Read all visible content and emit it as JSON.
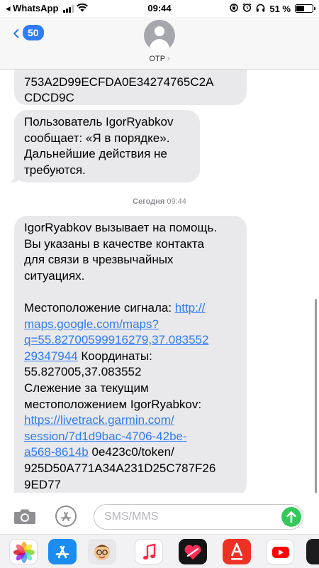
{
  "status_bar": {
    "back_app": "◂ WhatsApp",
    "time": "09:44",
    "battery_text": "51 %",
    "battery_level_percent": 51
  },
  "header": {
    "back_badge": "50",
    "contact_name": "OTP",
    "contact_chevron": "›"
  },
  "messages": {
    "msg1": {
      "lines": [
        "753A2D99ECFDA0E34274765C2A",
        "CDCD9C"
      ]
    },
    "msg2": {
      "lines": [
        "Пользователь IgorRyabkov",
        "сообщает: «Я в порядке».",
        "Дальнейшие действия не",
        "требуются."
      ]
    },
    "timestamp": {
      "day": "Сегодня",
      "time": "09:44"
    },
    "msg3": {
      "intro": [
        "IgorRyabkov вызывает на помощь.",
        "Вы указаны в качестве контакта",
        "для связи в чрезвычайных",
        "ситуациях."
      ],
      "location_label": "Местоположение сигнала: ",
      "map_link": [
        "http://",
        "maps.google.com/maps?",
        "q=55.82700599916279,37.083552",
        "29347944"
      ],
      "coords_label": " Координаты:",
      "coords_value": "55.827005,37.083552",
      "tracking_line1": "Слежение за текущим",
      "tracking_line2": "местоположением IgorRyabkov:",
      "track_link": [
        "https://livetrack.garmin.com/",
        "session/7d1d9bac-4706-42be-",
        "a568-8614b"
      ],
      "track_tail": " 0e423c0/token/",
      "token": [
        "925D50A771A34A231D25C787F26",
        "9ED77"
      ]
    }
  },
  "input": {
    "placeholder": "SMS/MMS"
  },
  "icons": {
    "camera": "camera-icon",
    "appstore": "app-store-icon",
    "send": "send-arrow-icon",
    "drawer": [
      "photos-app-icon",
      "app-store-app-icon",
      "memoji-app-icon",
      "music-app-icon",
      "digital-touch-app-icon",
      "alfa-bank-app-icon",
      "youtube-app-icon",
      "more-app-icon"
    ]
  },
  "colors": {
    "link": "#2f7cf6",
    "bubble": "#e9e9eb",
    "send": "#34c759"
  }
}
